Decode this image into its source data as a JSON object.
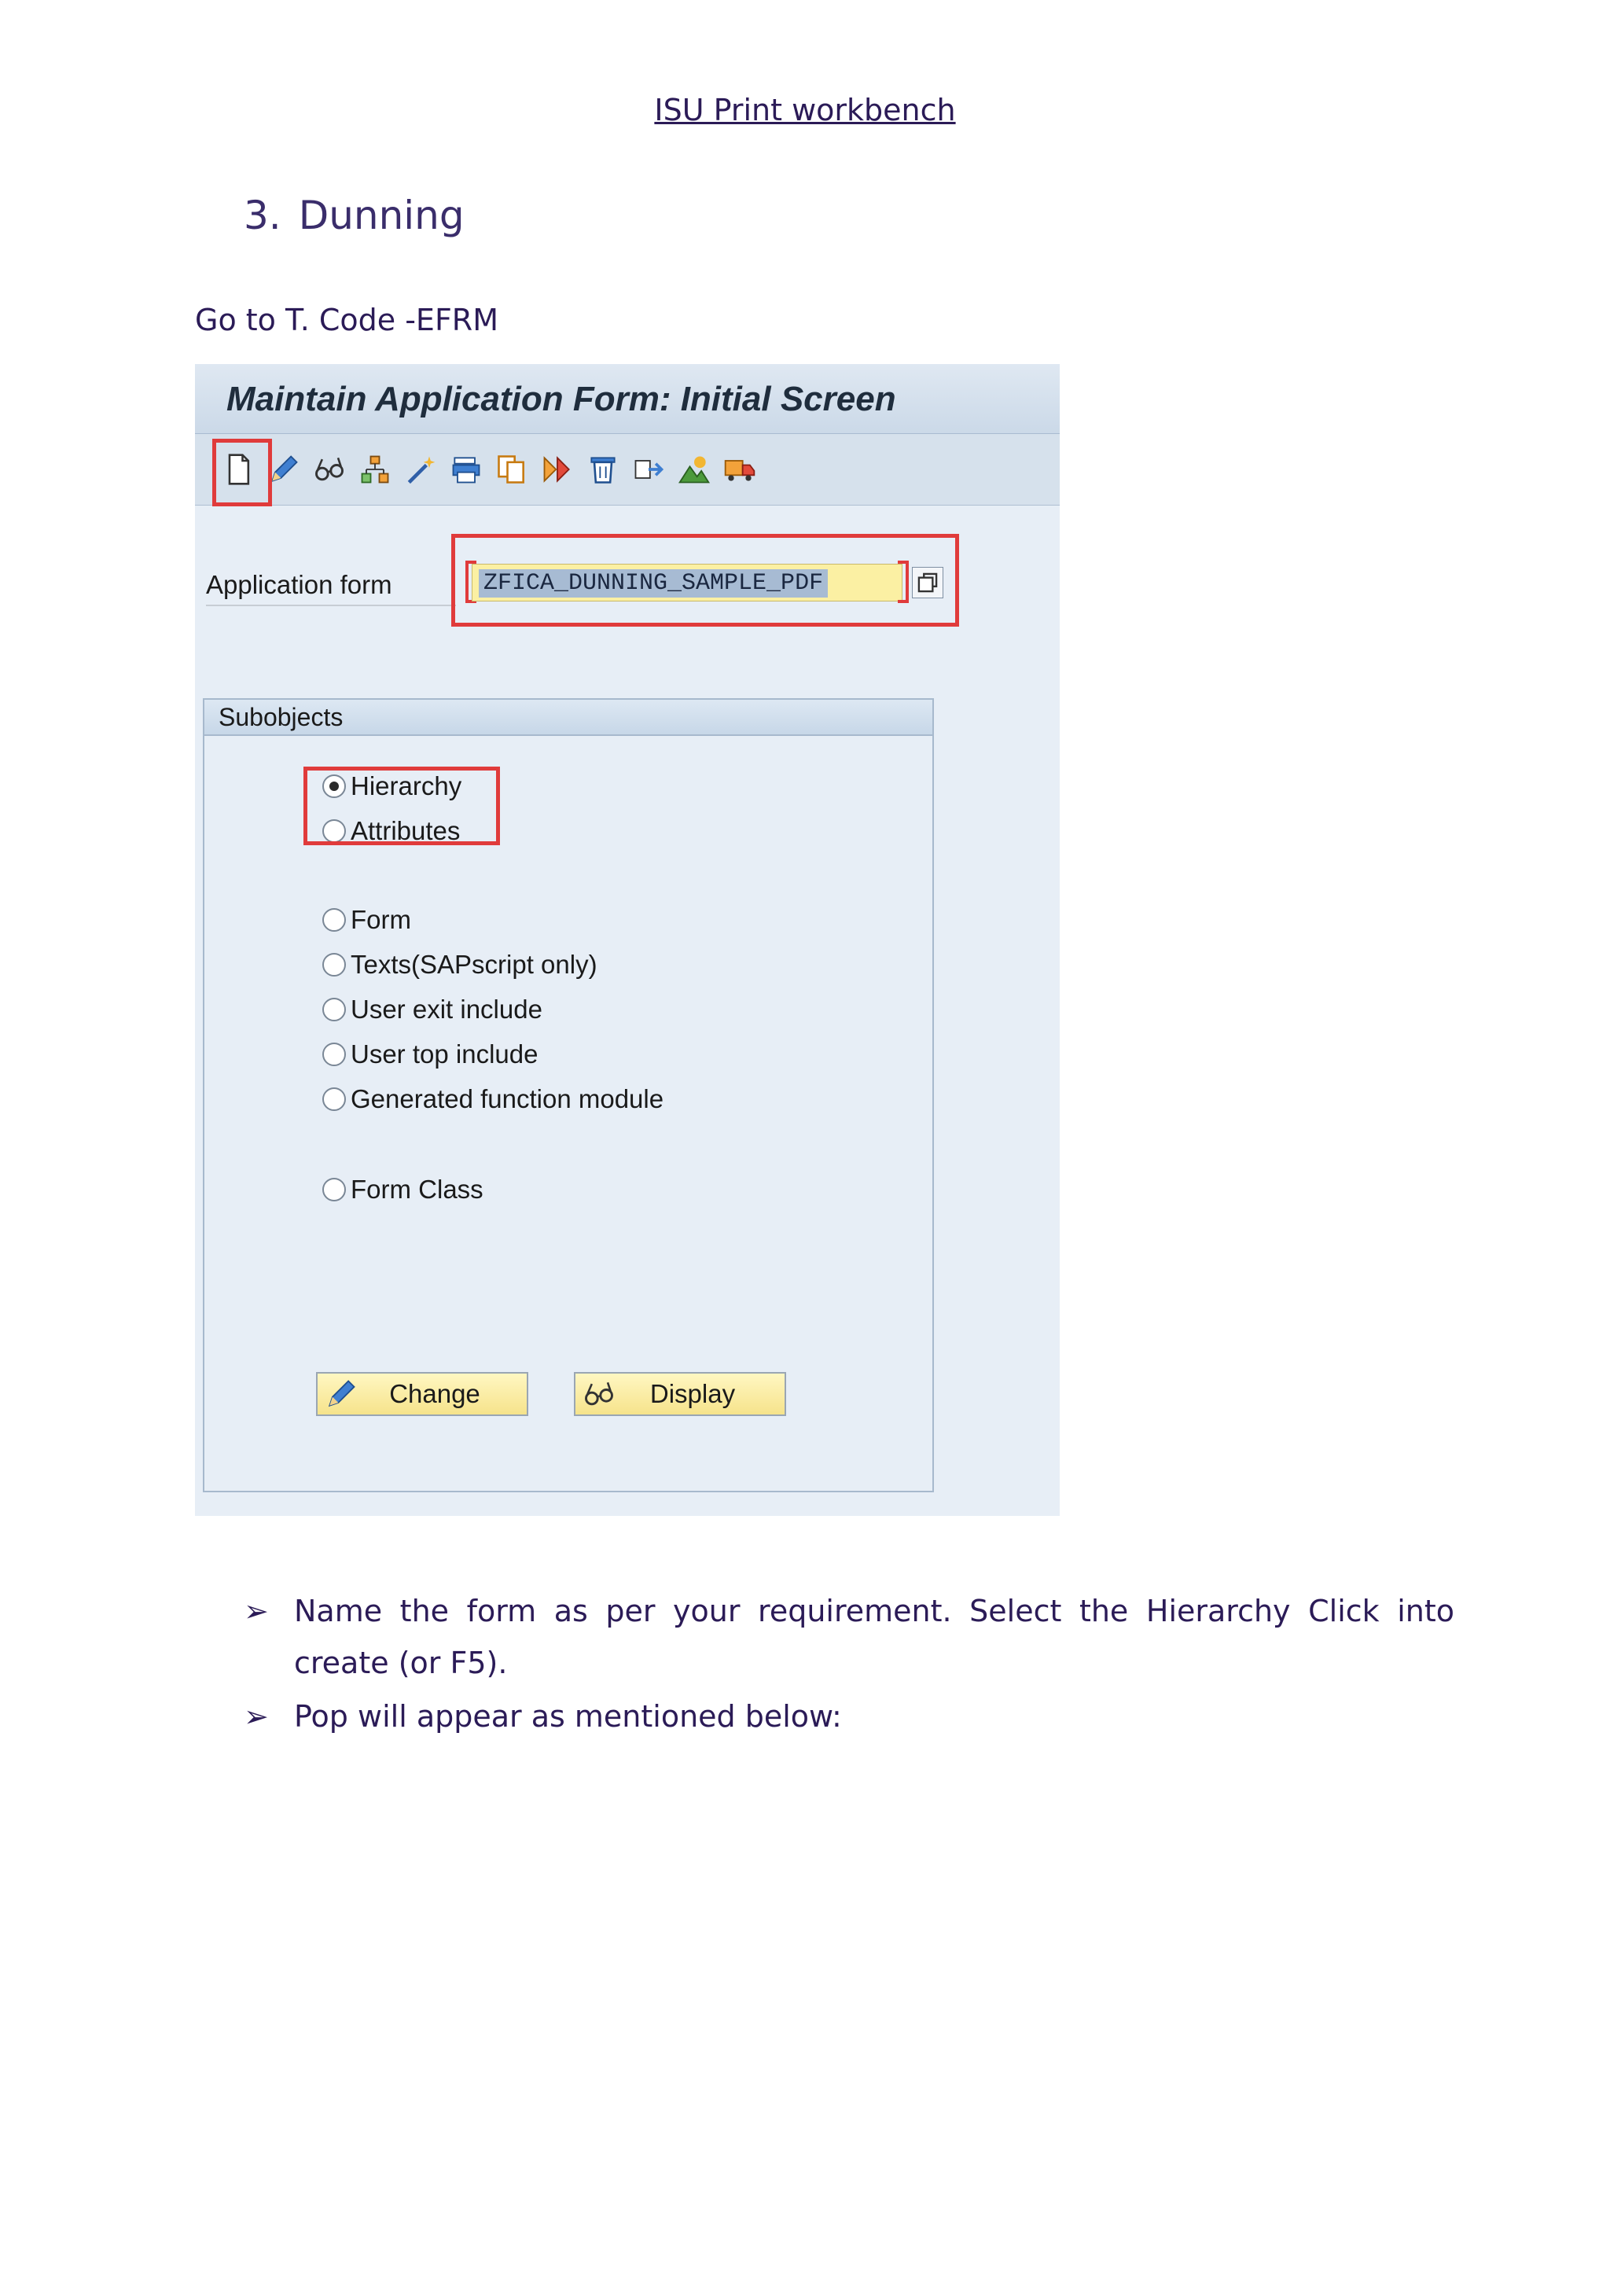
{
  "header": {
    "title": "ISU Print workbench"
  },
  "section": {
    "number": "3.",
    "title": "Dunning"
  },
  "intro": "Go to T. Code -EFRM",
  "sap": {
    "title": "Maintain Application Form: Initial Screen",
    "toolbar_icons": [
      "create-icon",
      "edit-pencil-icon",
      "display-glasses-icon",
      "hierarchy-icon",
      "magic-wand-icon",
      "print-icon",
      "copy-icon",
      "compare-icon",
      "delete-icon",
      "export-icon",
      "mountain-icon",
      "transport-icon"
    ],
    "application_form": {
      "label": "Application form",
      "value": "ZFICA_DUNNING_SAMPLE_PDF"
    },
    "subobjects": {
      "title": "Subobjects",
      "options": {
        "hierarchy": "Hierarchy",
        "attributes": "Attributes",
        "form": "Form",
        "texts": "Texts(SAPscript only)",
        "user_exit": "User exit include",
        "user_top": "User top include",
        "generated_fm": "Generated function module",
        "form_class": "Form Class"
      },
      "selected": "Hierarchy"
    },
    "buttons": {
      "change": "Change",
      "display": "Display"
    },
    "colors": {
      "highlight": "#e03b3b",
      "input_bg": "#fbf0a3",
      "button_bg": "#f6e38b"
    }
  },
  "bullets": [
    "Name the form as per your requirement. Select the Hierarchy Click into create (or F5).",
    "Pop will appear as mentioned below:"
  ]
}
